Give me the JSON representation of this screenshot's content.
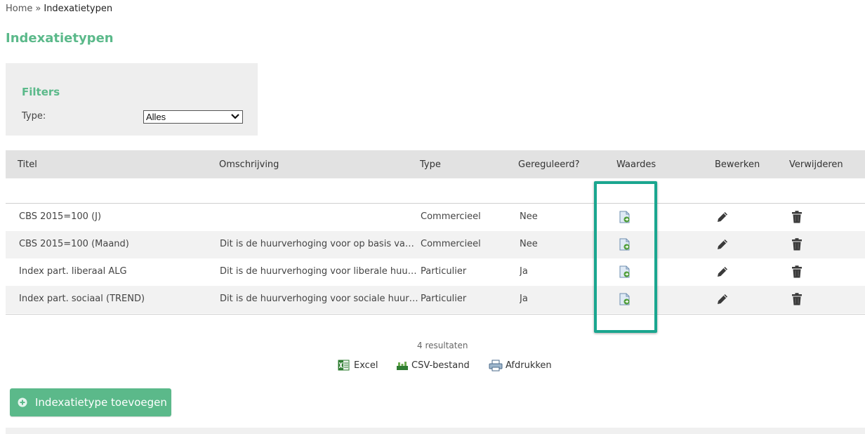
{
  "breadcrumb": {
    "home": "Home",
    "separator": "»",
    "current": "Indexatietypen"
  },
  "page_title": "Indexatietypen",
  "filters": {
    "title": "Filters",
    "type_label": "Type:",
    "type_value": "Alles"
  },
  "table": {
    "headers": {
      "titel": "Titel",
      "omschrijving": "Omschrijving",
      "type": "Type",
      "gereguleerd": "Gereguleerd?",
      "waardes": "Waardes",
      "bewerken": "Bewerken",
      "verwijderen": "Verwijderen"
    },
    "rows": [
      {
        "titel": "CBS 2015=100 (J)",
        "omschrijving": "",
        "type": "Commercieel",
        "gereguleerd": "Nee"
      },
      {
        "titel": "CBS 2015=100 (Maand)",
        "omschrijving": "Dit is de huurverhoging voor op basis van ...",
        "type": "Commercieel",
        "gereguleerd": "Nee"
      },
      {
        "titel": "Index part. liberaal ALG",
        "omschrijving": "Dit is de huurverhoging voor liberale huur...",
        "type": "Particulier",
        "gereguleerd": "Ja"
      },
      {
        "titel": "Index part. sociaal (TREND)",
        "omschrijving": "Dit is de huurverhoging voor sociale huurw...",
        "type": "Particulier",
        "gereguleerd": "Ja"
      }
    ]
  },
  "results": "4 resultaten",
  "export": {
    "excel": "Excel",
    "csv": "CSV-bestand",
    "print": "Afdrukken"
  },
  "add_button": "Indexatietype toevoegen",
  "colors": {
    "accent": "#5bb98a",
    "highlight": "#1aa68f"
  },
  "icons": {
    "waardes": "document-arrow-icon",
    "bewerken": "pencil-icon",
    "verwijderen": "trash-icon",
    "excel": "excel-icon",
    "csv": "csv-icon",
    "print": "printer-icon",
    "add": "plus-circle-icon",
    "dropdown": "chevron-down-icon"
  }
}
